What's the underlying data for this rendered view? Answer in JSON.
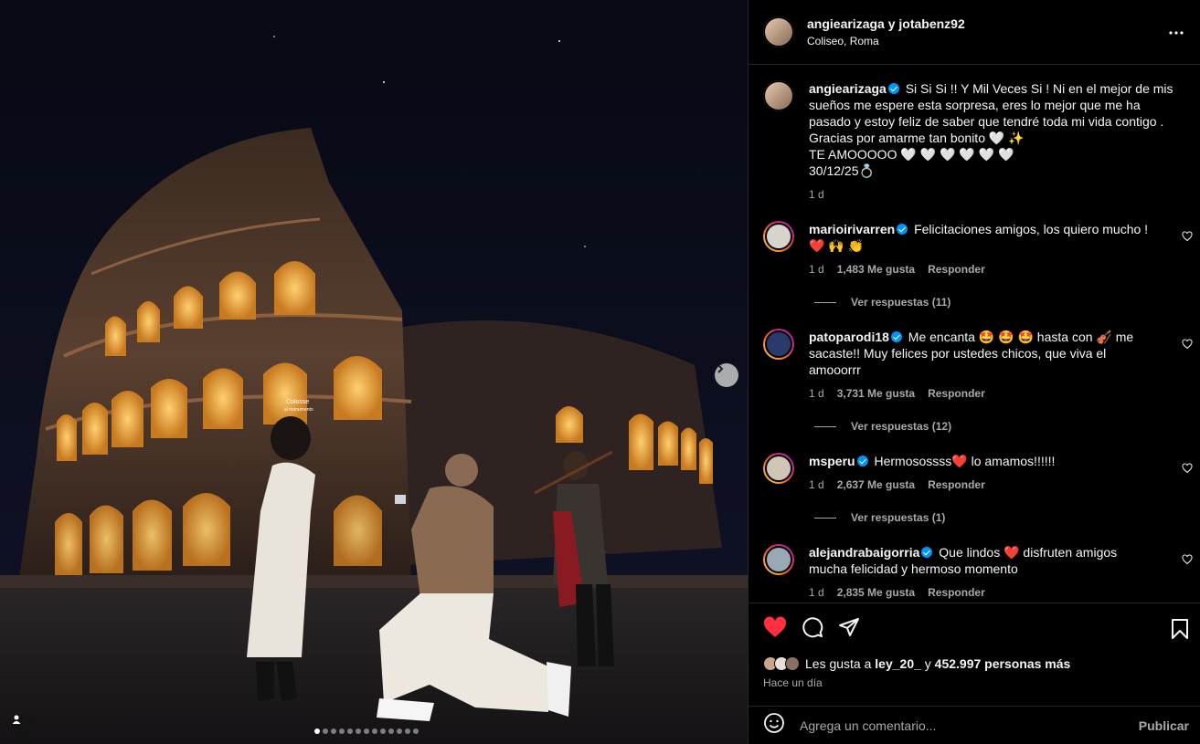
{
  "header": {
    "title": "angiearizaga y jotabenz92",
    "location": "Coliseo, Roma"
  },
  "caption": {
    "username": "angiearizaga",
    "text": "Si Si Si !! Y Mil Veces Si ! Ni en el mejor de mis sueños me espere esta sorpresa, eres lo mejor que me ha pasado y estoy feliz de saber que tendré toda mi vida contigo . Gracias por amarme tan bonito 🤍 ✨",
    "line2": "TE AMOOOOO 🤍 🤍 🤍 🤍 🤍 🤍",
    "line3": "30/12/25💍",
    "time": "1 d"
  },
  "comments": [
    {
      "username": "marioirivarren",
      "text": "Felicitaciones amigos, los quiero mucho ! ❤️ 🙌 👏",
      "time": "1 d",
      "likes": "1,483 Me gusta",
      "reply": "Responder",
      "view_replies": "Ver respuestas (11)",
      "avatar_color": "#d8d4cc"
    },
    {
      "username": "patoparodi18",
      "text": "Me encanta 🤩 🤩 🤩 hasta con 🎻 me sacaste!! Muy felices por ustedes chicos, que viva el amooorrr",
      "time": "1 d",
      "likes": "3,731 Me gusta",
      "reply": "Responder",
      "view_replies": "Ver respuestas (12)",
      "avatar_color": "#2a3a6a"
    },
    {
      "username": "msperu",
      "text": "Hermosossss❤️  lo amamos!!!!!!",
      "time": "1 d",
      "likes": "2,637 Me gusta",
      "reply": "Responder",
      "view_replies": "Ver respuestas (1)",
      "avatar_color": "#cfc6b8"
    },
    {
      "username": "alejandrabaigorria",
      "text": "Que lindos ❤️ disfruten amigos mucha felicidad y hermoso momento",
      "time": "1 d",
      "likes": "2,835 Me gusta",
      "reply": "Responder",
      "avatar_color": "#9aa7b5"
    }
  ],
  "actions": {
    "likes_prefix": "Les gusta a",
    "likes_user": "ley_20_",
    "likes_mid": "y",
    "likes_count": "452.997 personas más",
    "time": "Hace un día"
  },
  "add_comment": {
    "placeholder": "Agrega un comentario...",
    "publish": "Publicar"
  },
  "photo": {
    "sign_line1": "Colosse",
    "sign_line2": "al monumento",
    "slide_count": 13,
    "active_slide": 1
  },
  "colors": {
    "like_red": "#ff3040",
    "verified_blue": "#0095f6",
    "arch_glow": "#f0a830"
  }
}
